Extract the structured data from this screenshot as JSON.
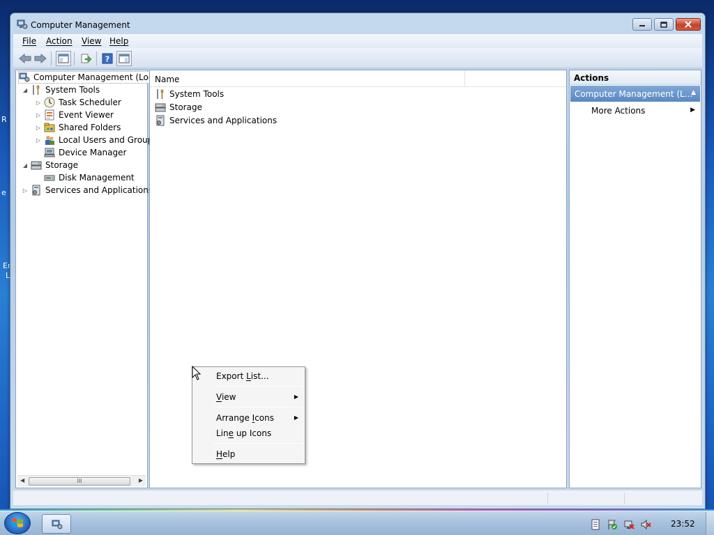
{
  "desktop": {
    "fragments": [
      "R",
      "e",
      "En",
      "L"
    ]
  },
  "window": {
    "title": "Computer Management",
    "menu": [
      {
        "label": "File"
      },
      {
        "label": "Action"
      },
      {
        "label": "View"
      },
      {
        "label": "Help"
      }
    ],
    "toolbar": [
      "back-arrow-icon",
      "forward-arrow-icon",
      "show-hide-console-tree-icon",
      "export-list-icon",
      "help-icon",
      "show-hide-action-pane-icon"
    ]
  },
  "tree": {
    "items": [
      {
        "label": "Computer Management (Local",
        "icon": "computer-management-icon",
        "expanded": null
      },
      {
        "label": "System Tools",
        "icon": "system-tools-icon",
        "expanded": true
      },
      {
        "label": "Task Scheduler",
        "icon": "clock-icon",
        "expanded": false
      },
      {
        "label": "Event Viewer",
        "icon": "event-viewer-icon",
        "expanded": false
      },
      {
        "label": "Shared Folders",
        "icon": "shared-folders-icon",
        "expanded": false
      },
      {
        "label": "Local Users and Groups",
        "icon": "users-icon",
        "expanded": false
      },
      {
        "label": "Device Manager",
        "icon": "device-manager-icon",
        "expanded": null
      },
      {
        "label": "Storage",
        "icon": "storage-icon",
        "expanded": true
      },
      {
        "label": "Disk Management",
        "icon": "disk-icon",
        "expanded": null
      },
      {
        "label": "Services and Applications",
        "icon": "services-icon",
        "expanded": false
      }
    ],
    "scroll_grip": "III"
  },
  "center": {
    "column_header": "Name",
    "rows": [
      {
        "label": "System Tools"
      },
      {
        "label": "Storage"
      },
      {
        "label": "Services and Applications"
      }
    ]
  },
  "actions": {
    "title": "Actions",
    "section": "Computer Management (L...",
    "more": "More Actions"
  },
  "context_menu": {
    "items": [
      {
        "pre": "Export ",
        "u": "L",
        "post": "ist..."
      },
      {
        "pre": "",
        "u": "V",
        "post": "iew",
        "submenu": true
      },
      {
        "pre": "Arrange ",
        "u": "I",
        "post": "cons",
        "submenu": true
      },
      {
        "pre": "Lin",
        "u": "e",
        "post": " up Icons"
      },
      {
        "pre": "",
        "u": "H",
        "post": "elp"
      }
    ]
  },
  "taskbar": {
    "clock": "23:52"
  },
  "colors": {
    "actions_section": "#5a88c2",
    "close_button": "#c7402a",
    "desktop": "#1a5bbd"
  }
}
